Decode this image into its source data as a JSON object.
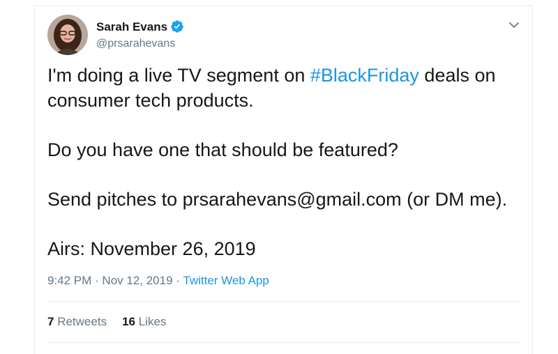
{
  "author": {
    "name": "Sarah Evans",
    "handle": "@prsarahevans",
    "verified_color": "#1da1f2"
  },
  "tweet": {
    "line1_before": "I'm doing a live TV segment on ",
    "hashtag": "#BlackFriday",
    "line1_after": " deals on consumer tech products.",
    "paragraph2": "Do you have one that should be featured?",
    "paragraph3": "Send pitches to prsarahevans@gmail.com (or DM me).",
    "paragraph4": "Airs: November 26, 2019"
  },
  "meta": {
    "time": "9:42 PM",
    "separator1": " · ",
    "date": "Nov 12, 2019",
    "separator2": " · ",
    "source": "Twitter Web App"
  },
  "stats": {
    "retweets_count": "7",
    "retweets_label": "Retweets",
    "likes_count": "16",
    "likes_label": "Likes"
  },
  "colors": {
    "link": "#1b95e0",
    "secondary_text": "#657786",
    "divider": "#e6ecf0"
  },
  "icons": {
    "verified": "verified-badge-icon",
    "menu": "chevron-down-icon"
  }
}
